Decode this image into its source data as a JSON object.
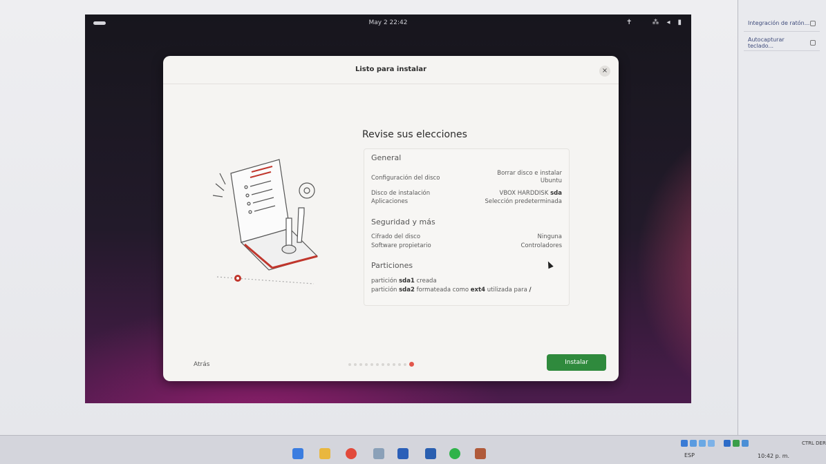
{
  "host": {
    "side_buttons": [
      "Integración de ratón...",
      "Autocapturar teclado..."
    ],
    "host_key": "CTRL DER",
    "lang": "ESP",
    "time": "10:42 p. m."
  },
  "vm_topbar": {
    "clock": "May 2  22:42"
  },
  "dialog": {
    "title": "Listo para instalar",
    "close_icon": "×",
    "heading": "Revise sus elecciones",
    "sections": {
      "general": {
        "title": "General",
        "disk_config_label": "Configuración del disco",
        "disk_config_value_line1": "Borrar disco e instalar",
        "disk_config_value_line2": "Ubuntu",
        "install_disk_label": "Disco de instalación",
        "install_disk_value": "VBOX HARDDISK",
        "install_disk_value_bold": "sda",
        "apps_label": "Aplicaciones",
        "apps_value": "Selección predeterminada"
      },
      "security": {
        "title": "Seguridad y más",
        "encryption_label": "Cifrado del disco",
        "encryption_value": "Ninguna",
        "proprietary_label": "Software propietario",
        "proprietary_value": "Controladores"
      },
      "partitions": {
        "title": "Particiones",
        "p1_a": "partición",
        "p1_b": "sda1",
        "p1_c": "creada",
        "p2_a": "partición",
        "p2_b": "sda2",
        "p2_c": "formateada como",
        "p2_d": "ext4",
        "p2_e": "utilizada para",
        "p2_f": "/"
      }
    },
    "back_label": "Atrás",
    "install_label": "Instalar",
    "progress_total_steps": 12,
    "progress_current_step": 12
  },
  "colors": {
    "accent_install": "#2f8a3d",
    "progress_active": "#e2574c"
  }
}
